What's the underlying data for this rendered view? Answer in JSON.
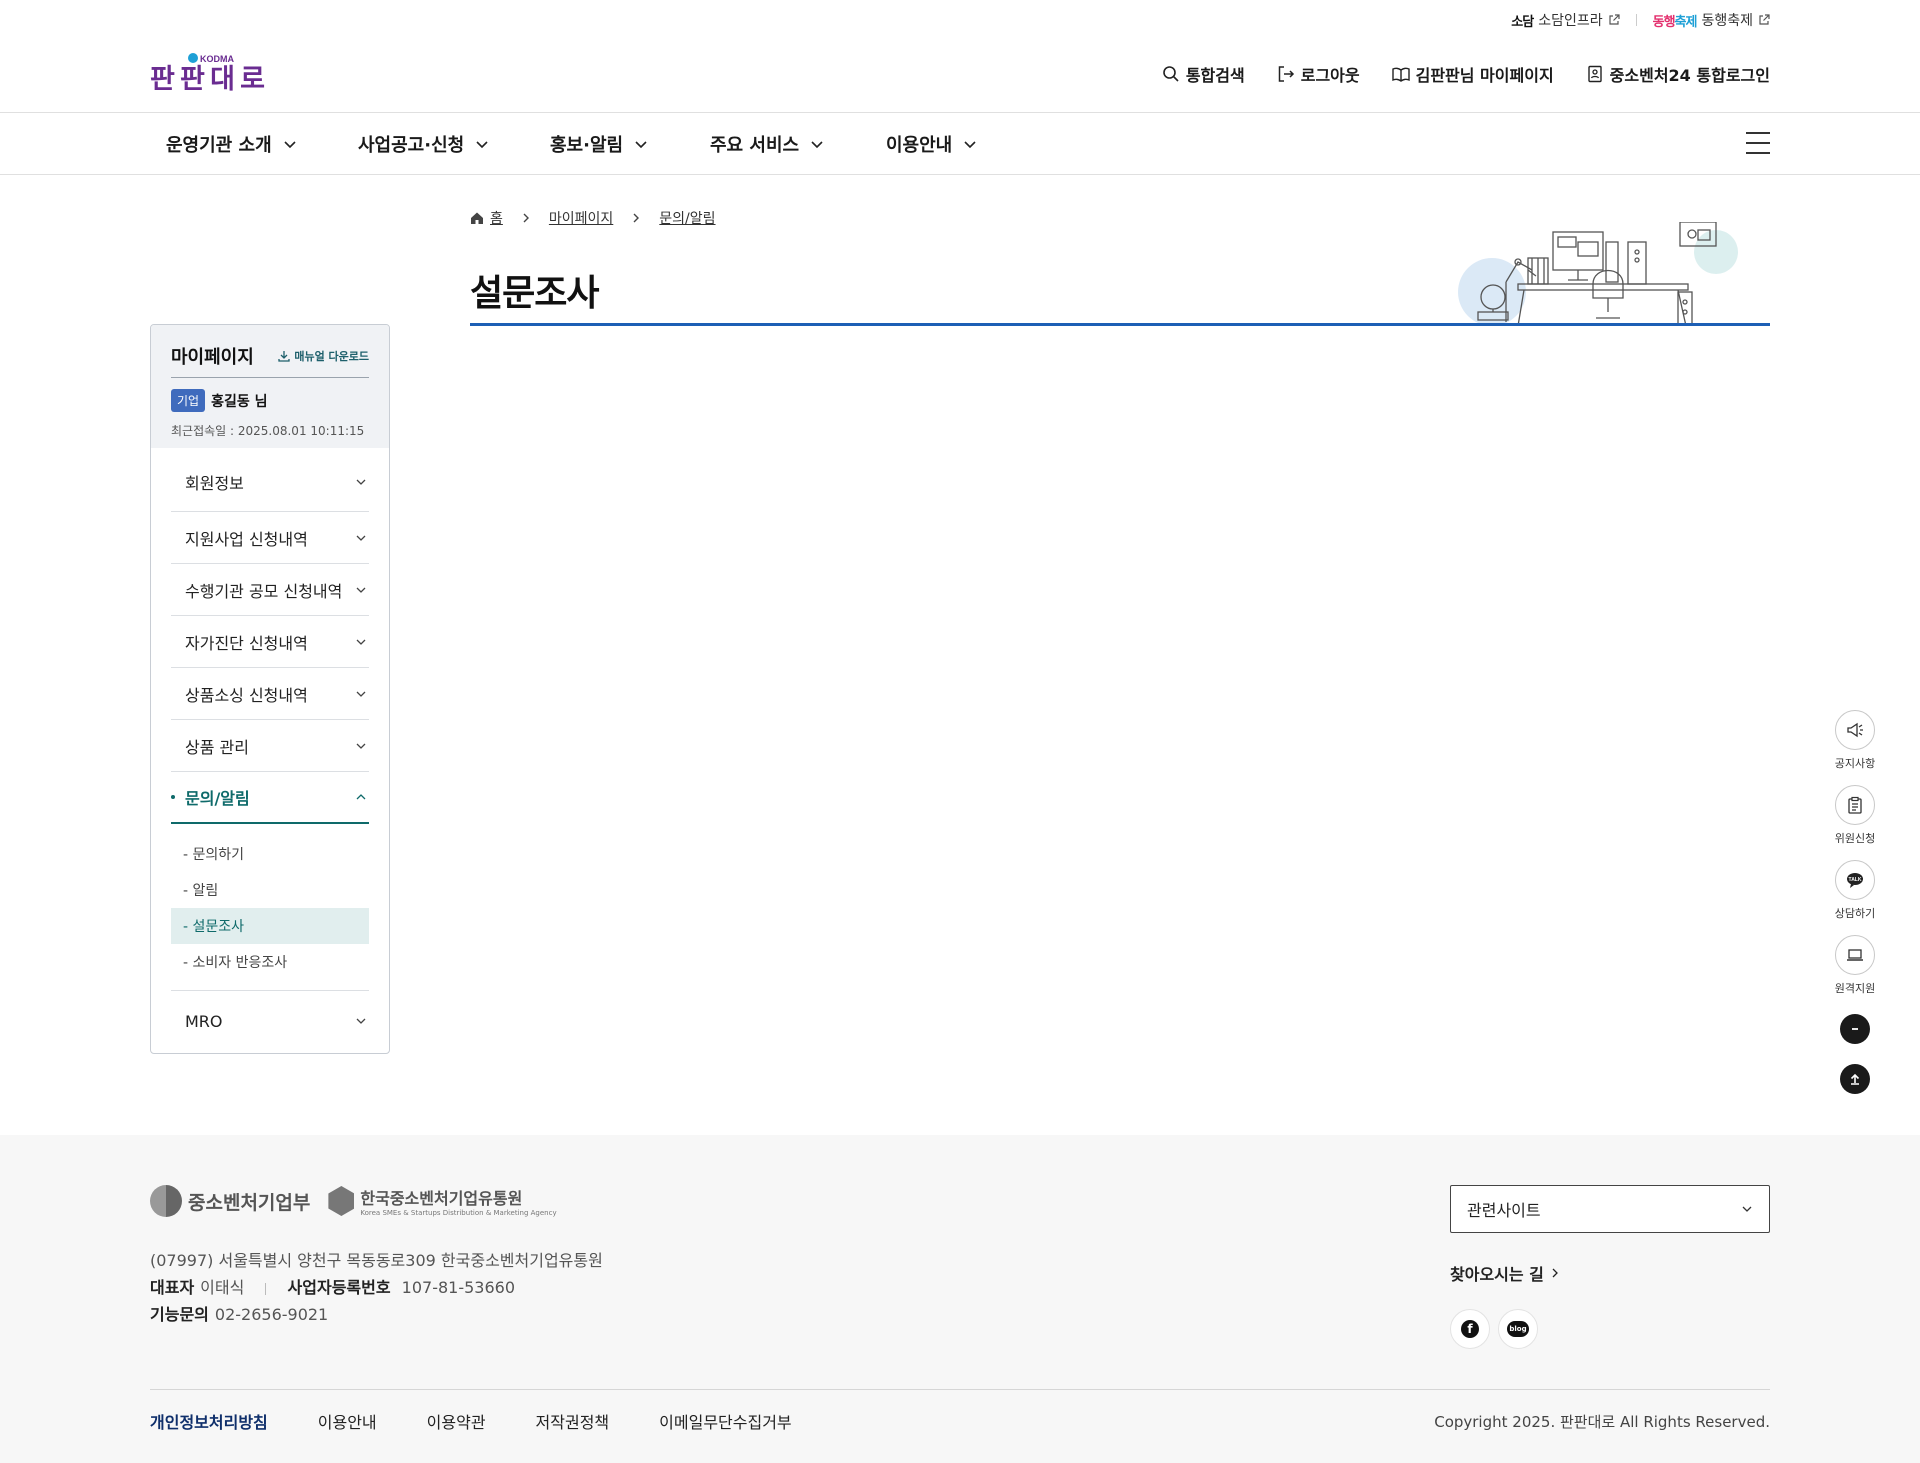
{
  "util_links": [
    {
      "brand": "소담",
      "label": "소담인프라"
    },
    {
      "brand_a": "동행",
      "brand_b": "축제",
      "label": "동행축제"
    }
  ],
  "logo": {
    "text": "판판대로",
    "sub": "KODMA"
  },
  "header_util": {
    "search": "통합검색",
    "logout": "로그아웃",
    "mypage": "김판판님 마이페이지",
    "sso": "중소벤처24 통합로그인"
  },
  "main_nav": [
    "운영기관 소개",
    "사업공고·신청",
    "홍보·알림",
    "주요 서비스",
    "이용안내"
  ],
  "breadcrumb": {
    "home": "홈",
    "level1": "마이페이지",
    "level2": "문의/알림"
  },
  "page_title": "설문조사",
  "sidebar": {
    "title": "마이페이지",
    "manual": "매뉴얼 다운로드",
    "badge": "기업",
    "user": "홍길동 님",
    "last_login": "최근접속일 : 2025.08.01 10:11:15",
    "items": [
      "회원정보",
      "지원사업 신청내역",
      "수행기관 공모 신청내역",
      "자가진단 신청내역",
      "상품소싱 신청내역",
      "상품 관리",
      "문의/알림",
      "MRO"
    ],
    "sub_items": [
      "- 문의하기",
      "- 알림",
      "- 설문조사",
      "- 소비자 반응조사"
    ]
  },
  "quick": [
    "공지사항",
    "위원신청",
    "상담하기",
    "원격지원"
  ],
  "footer": {
    "org1": "중소벤처기업부",
    "org2": "한국중소벤처기업유통원",
    "org2_en": "Korea SMEs & Startups Distribution & Marketing Agency",
    "address": "(07997) 서울특별시 양천구 목동동로309 한국중소벤처기업유통원",
    "ceo_label": "대표자",
    "ceo": "이태식",
    "bizno_label": "사업자등록번호",
    "bizno": "107-81-53660",
    "tel_label": "기능문의",
    "tel": "02-2656-9021",
    "related": "관련사이트",
    "directions": "찾아오시는 길",
    "links": [
      "개인정보처리방침",
      "이용안내",
      "이용약관",
      "저작권정책",
      "이메일무단수집거부"
    ],
    "copyright": "Copyright 2025. 판판대로 All Rights Reserved."
  },
  "colors": {
    "accent_blue": "#1d5fb5",
    "accent_teal": "#0e6a6a",
    "badge": "#3f6bbd",
    "logo_purple": "#6a2c91"
  }
}
